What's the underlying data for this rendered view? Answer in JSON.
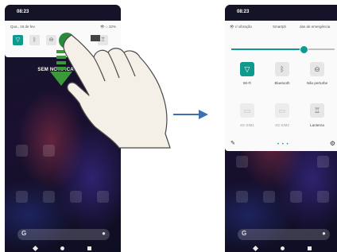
{
  "left_phone": {
    "time": "08:23",
    "date": "Qua., 16 de fev.",
    "battery": "👁 ⌂ 32%",
    "tiles": [
      "wifi",
      "bluetooth",
      "dnd",
      "flashlight"
    ],
    "notifications_text": "SEM NOTIFICAÇÕES"
  },
  "right_phone": {
    "time": "08:23",
    "modes": [
      "r/ vibração",
      "Smartph",
      "das de emergência"
    ],
    "tiles": [
      {
        "label": "Wi-Fi",
        "icon": "wifi-icon",
        "active": true
      },
      {
        "label": "Bluetooth",
        "icon": "bluetooth-icon",
        "active": false
      },
      {
        "label": "Não perturbe",
        "icon": "dnd-icon",
        "active": false
      },
      {
        "label": "4G SIM1",
        "icon": "sim-icon",
        "active": false
      },
      {
        "label": "4G SIM2",
        "icon": "sim-icon",
        "active": false
      },
      {
        "label": "Lanterna",
        "icon": "flashlight-icon",
        "active": false
      }
    ],
    "page_dots": "• • •"
  },
  "colors": {
    "accent": "#0e9a8c",
    "arrow": "#3e6fb3"
  }
}
